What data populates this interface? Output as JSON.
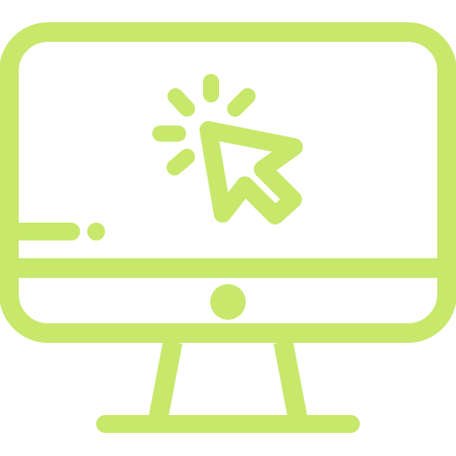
{
  "icon": {
    "name": "computer-click-icon",
    "parts": [
      "monitor-icon",
      "cursor-arrow-icon",
      "click-burst-icon",
      "power-button-icon",
      "monitor-stand-icon"
    ]
  },
  "colors": {
    "stroke": "#c7e86b",
    "background": "#ffffff"
  }
}
